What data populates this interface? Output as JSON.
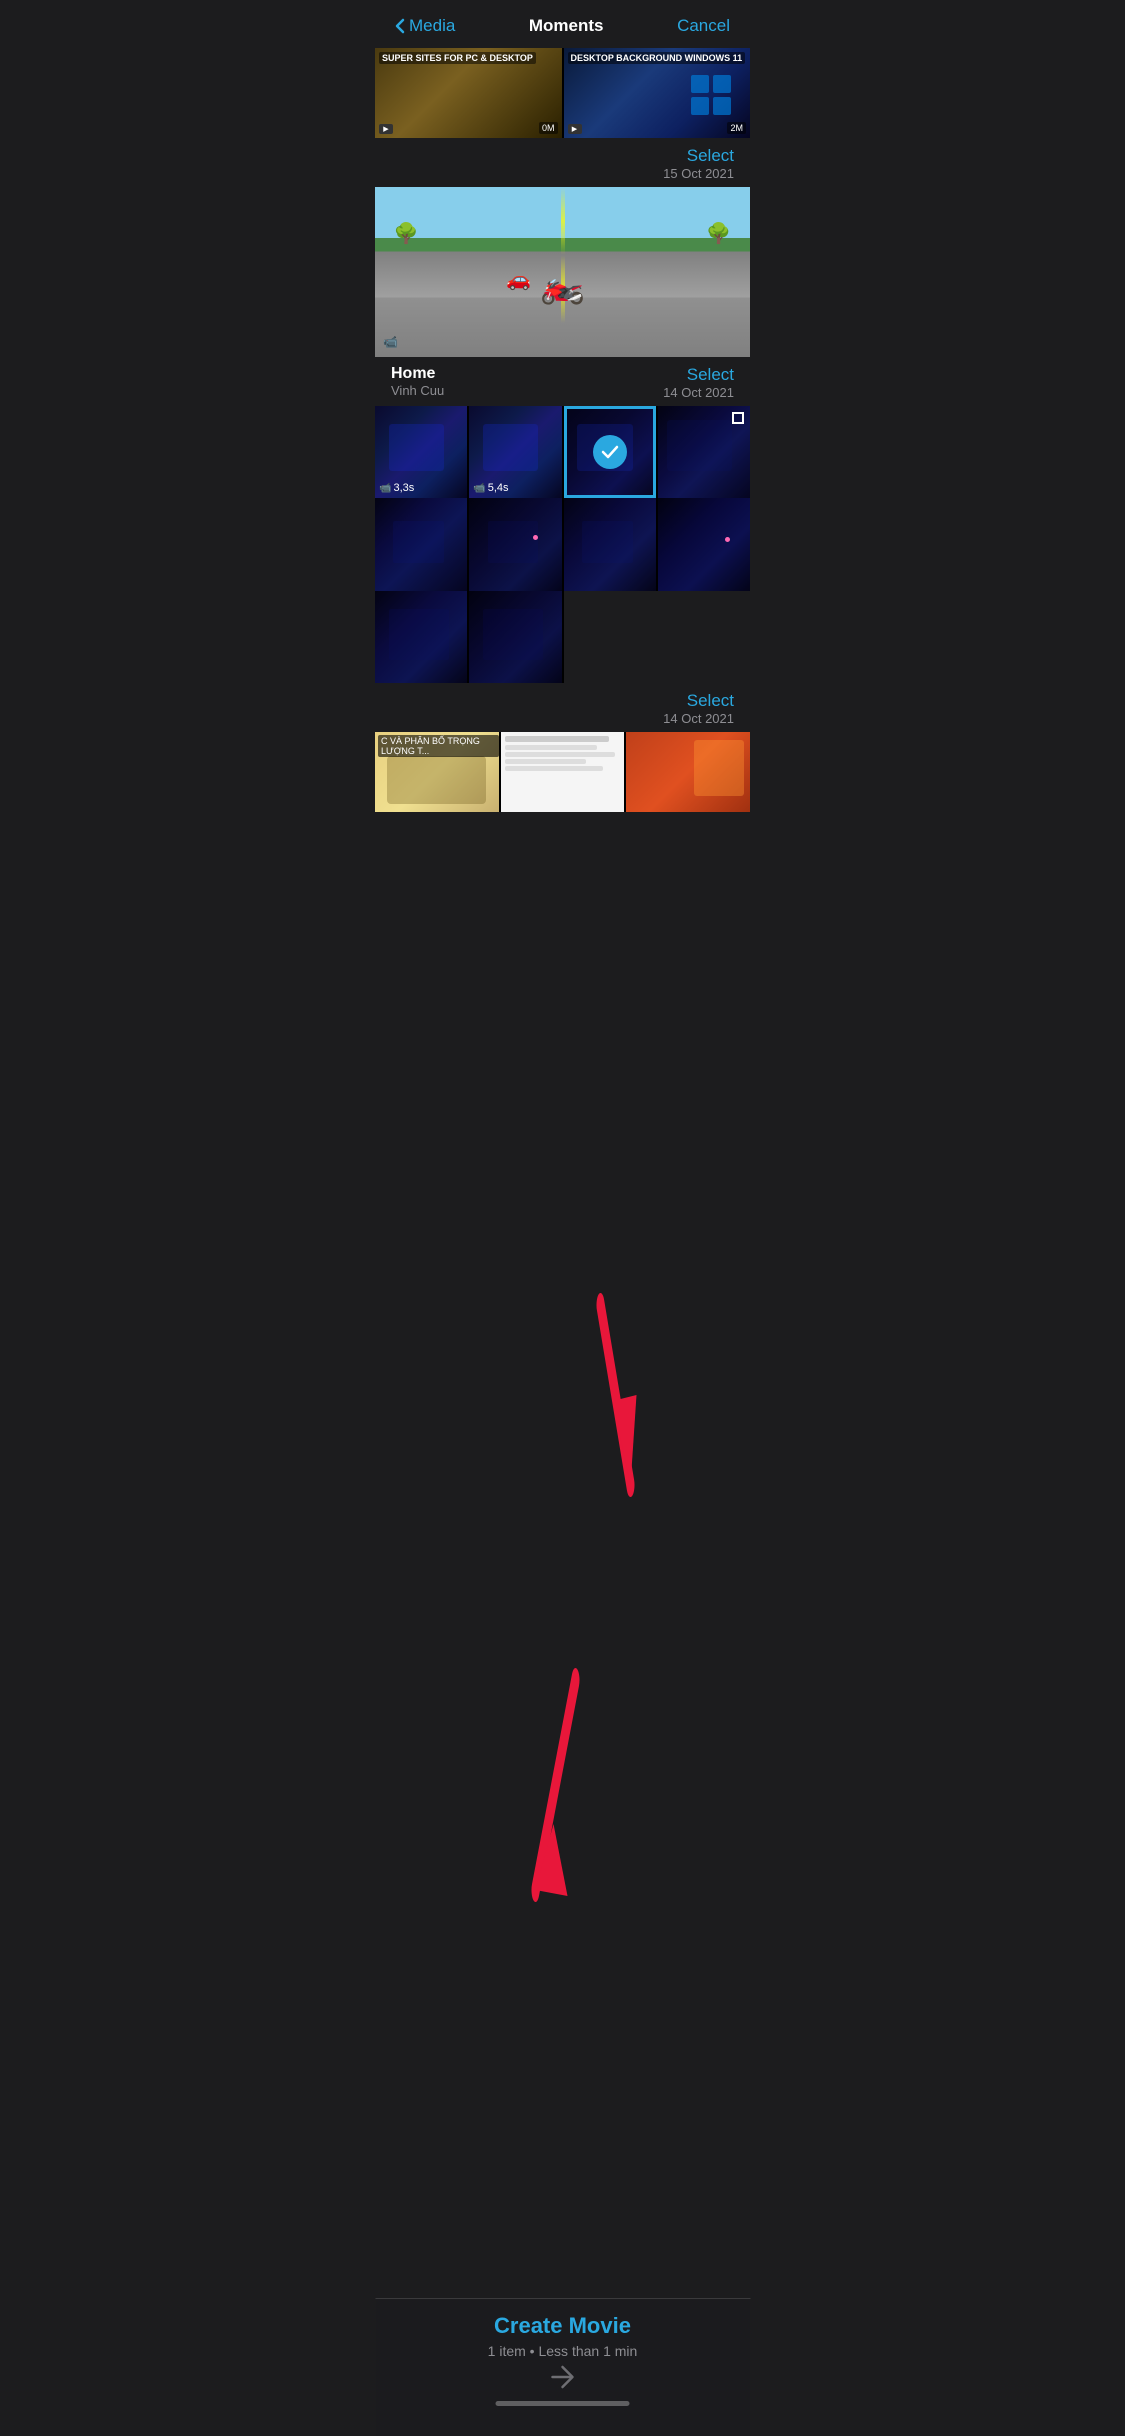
{
  "header": {
    "back_label": "Media",
    "title": "Moments",
    "cancel_label": "Cancel"
  },
  "sections": [
    {
      "id": "section-oct15",
      "title": "",
      "subtitle": "",
      "select_label": "Select",
      "date": "15 Oct 2021",
      "photos": [
        {
          "id": "p1",
          "type": "video",
          "label": "SUPER SITES FOR PC & DESKTOP",
          "bg": "olive-video"
        },
        {
          "id": "p2",
          "type": "video",
          "label": "DESKTOP BACKGROUND WINDOWS 11",
          "bg": "windows-video"
        }
      ]
    },
    {
      "id": "section-oct14-home",
      "title": "Home",
      "subtitle": "Vinh Cuu",
      "select_label": "Select",
      "date": "14 Oct 2021",
      "photos": [
        {
          "id": "p3",
          "type": "video",
          "label": "",
          "bg": "road-video"
        }
      ]
    },
    {
      "id": "section-oct14-room",
      "title": "",
      "subtitle": "",
      "select_label": "Select",
      "date": "14 Oct 2021",
      "photos": [
        {
          "id": "p4",
          "type": "video",
          "duration": "3,3s",
          "bg": "blue-room",
          "selected": false
        },
        {
          "id": "p5",
          "type": "video",
          "duration": "5,4s",
          "bg": "blue-room",
          "selected": false
        },
        {
          "id": "p6",
          "type": "photo",
          "bg": "blue-room",
          "selected": true
        },
        {
          "id": "p7",
          "type": "video",
          "bg": "blue-room-dark",
          "selected": false
        },
        {
          "id": "p8",
          "type": "photo",
          "bg": "blue-room",
          "selected": false
        },
        {
          "id": "p9",
          "type": "photo",
          "bg": "blue-room",
          "selected": false
        },
        {
          "id": "p10",
          "type": "photo",
          "bg": "blue-room",
          "selected": false
        },
        {
          "id": "p11",
          "type": "photo",
          "bg": "blue-room-dark",
          "selected": false
        },
        {
          "id": "p12",
          "type": "photo",
          "bg": "blue-room",
          "selected": false
        },
        {
          "id": "p13",
          "type": "photo",
          "bg": "blue-room",
          "selected": false
        }
      ]
    },
    {
      "id": "section-oct14-more",
      "title": "",
      "subtitle": "",
      "select_label": "Select",
      "date": "14 Oct 2021",
      "photos": [
        {
          "id": "p14",
          "type": "video",
          "bg": "cartoon-video"
        },
        {
          "id": "p15",
          "type": "video",
          "bg": "text-video"
        },
        {
          "id": "p16",
          "type": "photo",
          "bg": "orange-photo"
        }
      ]
    }
  ],
  "bottom_bar": {
    "create_label": "Create Movie",
    "subtitle": "1 item • Less than 1 min"
  },
  "arrows": {
    "up_arrow_color": "#e8173a",
    "down_arrow_color": "#e8173a"
  }
}
